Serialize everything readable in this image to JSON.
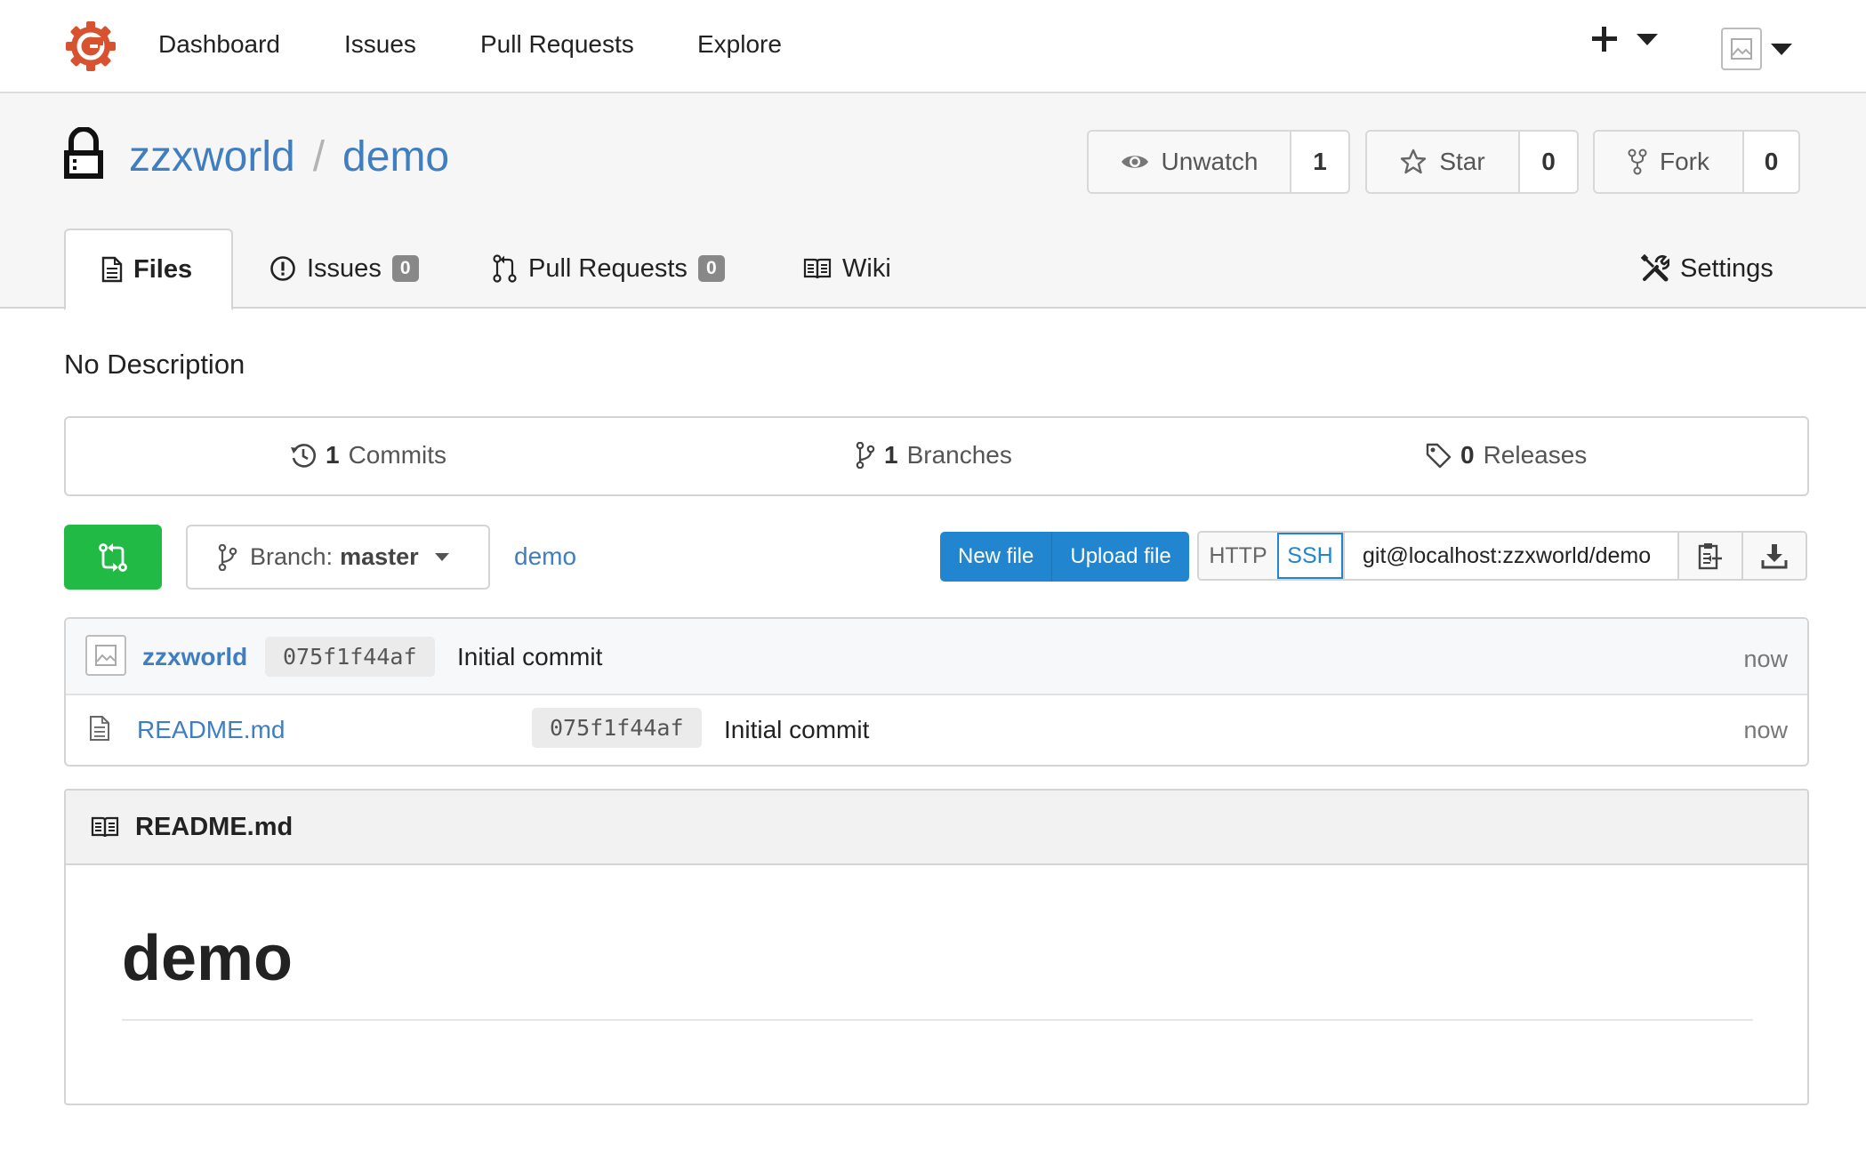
{
  "nav": {
    "items": [
      "Dashboard",
      "Issues",
      "Pull Requests",
      "Explore"
    ]
  },
  "repo": {
    "owner": "zzxworld",
    "separator": "/",
    "name": "demo",
    "watch": {
      "label": "Unwatch",
      "count": "1"
    },
    "star": {
      "label": "Star",
      "count": "0"
    },
    "fork": {
      "label": "Fork",
      "count": "0"
    }
  },
  "tabs": {
    "files": "Files",
    "issues": {
      "label": "Issues",
      "count": "0"
    },
    "pulls": {
      "label": "Pull Requests",
      "count": "0"
    },
    "wiki": "Wiki",
    "settings": "Settings"
  },
  "description": "No Description",
  "stats": {
    "commits": {
      "count": "1",
      "label": "Commits"
    },
    "branches": {
      "count": "1",
      "label": "Branches"
    },
    "releases": {
      "count": "0",
      "label": "Releases"
    }
  },
  "toolbar": {
    "branch_prefix": "Branch:",
    "branch_name": "master",
    "path": "demo",
    "new_file": "New file",
    "upload_file": "Upload file",
    "http": "HTTP",
    "ssh": "SSH",
    "clone_url": "git@localhost:zzxworld/demo"
  },
  "latest_commit": {
    "author": "zzxworld",
    "sha": "075f1f44af",
    "message": "Initial commit",
    "time": "now"
  },
  "files": [
    {
      "name": "README.md",
      "sha": "075f1f44af",
      "message": "Initial commit",
      "time": "now"
    }
  ],
  "readme": {
    "filename": "README.md",
    "heading": "demo"
  },
  "colors": {
    "link": "#3f7ec0",
    "primary": "#2185d0",
    "success": "#21ba45",
    "logo": "#d9522f"
  }
}
